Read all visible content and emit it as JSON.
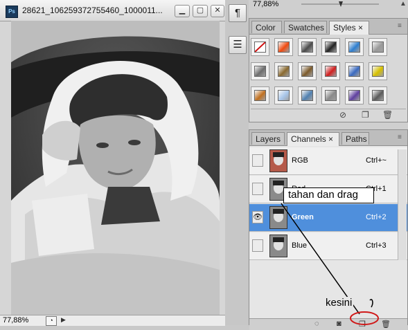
{
  "document": {
    "app_icon_label": "Ps",
    "title": "28621_106259372755460_1000011...",
    "buttons": {
      "minimize": "▁",
      "restore": "▢",
      "close": "✕"
    },
    "zoom": "77,88%"
  },
  "toolstrip": {
    "paragraph_icon": "¶",
    "notes_icon": "☰"
  },
  "top_bar": {
    "zoom": "77,88%"
  },
  "styles_panel": {
    "tabs": [
      "Color",
      "Swatches",
      "Styles"
    ],
    "active_tab": "Styles",
    "close_glyph": "×",
    "cells": [
      "none",
      "#f04a10",
      "#4a4a4a",
      "#222222",
      "#2f7fd0",
      "#9a9a9a",
      "#6d6d6d",
      "#8a6a30",
      "#7b5a2b",
      "#d02020",
      "#3a6ac0",
      "#d6c000",
      "#c07020",
      "#a8c6ea",
      "#5080b0",
      "#8a8a8a",
      "#6040a0",
      "#5a5a5a"
    ],
    "footer_icons": [
      "no-symbol-icon",
      "new-style-icon",
      "trash-icon"
    ]
  },
  "channels_panel": {
    "tabs": [
      "Layers",
      "Channels",
      "Paths"
    ],
    "active_tab": "Channels",
    "close_glyph": "×",
    "rows": [
      {
        "name": "RGB",
        "shortcut": "Ctrl+~",
        "visible": false,
        "selected": false
      },
      {
        "name": "Red",
        "shortcut": "Ctrl+1",
        "visible": false,
        "selected": false
      },
      {
        "name": "Green",
        "shortcut": "Ctrl+2",
        "visible": true,
        "selected": true
      },
      {
        "name": "Blue",
        "shortcut": "Ctrl+3",
        "visible": false,
        "selected": false
      }
    ],
    "eye_glyph": "👁"
  },
  "annotations": {
    "tooltip": "tahan dan drag",
    "target_label": "kesini"
  }
}
